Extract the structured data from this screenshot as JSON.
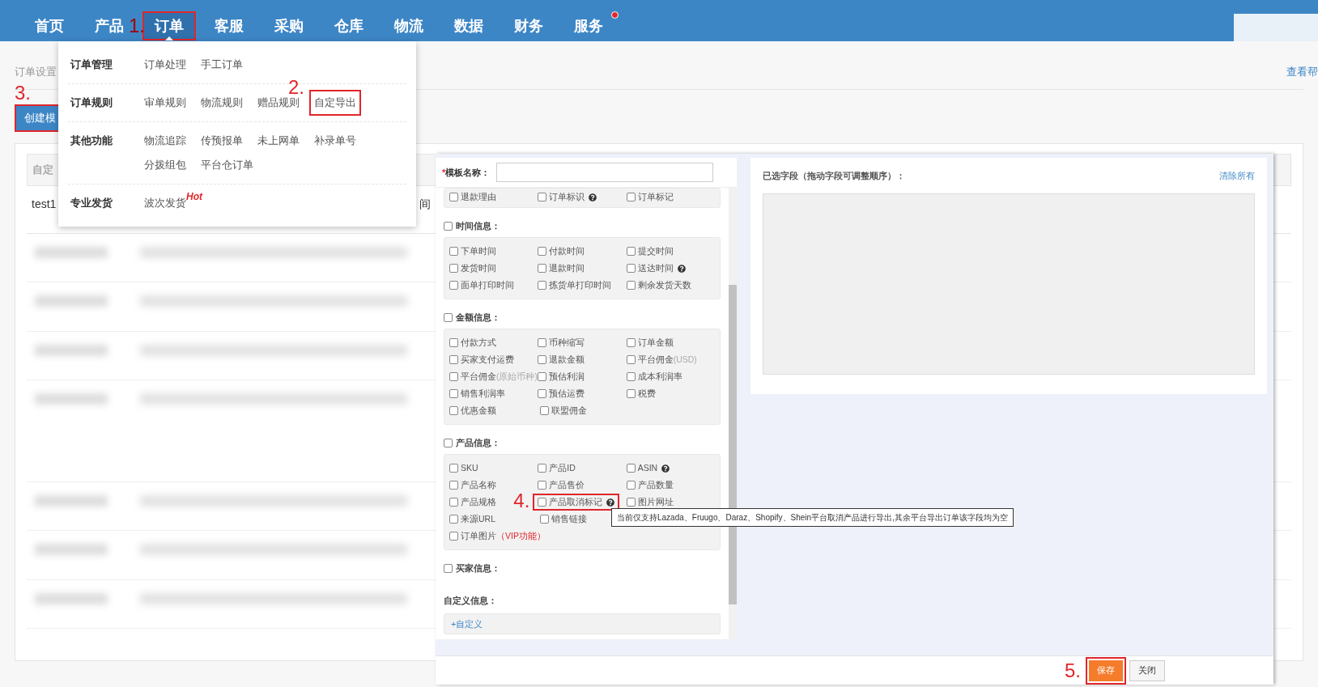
{
  "nav": {
    "items": [
      {
        "label": "首页",
        "selected": false
      },
      {
        "label": "产品",
        "selected": false
      },
      {
        "label": "订单",
        "selected": true,
        "step": "1."
      },
      {
        "label": "客服",
        "selected": false
      },
      {
        "label": "采购",
        "selected": false
      },
      {
        "label": "仓库",
        "selected": false
      },
      {
        "label": "物流",
        "selected": false
      },
      {
        "label": "数据",
        "selected": false
      },
      {
        "label": "财务",
        "selected": false
      },
      {
        "label": "服务",
        "selected": false,
        "badge": true
      }
    ]
  },
  "page": {
    "breadcrumb": "订单设置",
    "help_link": "查看帮",
    "create_button": {
      "label": "创建模",
      "step": "3."
    },
    "table": {
      "header": "自定",
      "rows": [
        {
          "cells": [
            "test1",
            "间"
          ]
        }
      ]
    }
  },
  "menu": {
    "groups": [
      {
        "title": "订单管理",
        "items": [
          {
            "label": "订单处理"
          },
          {
            "label": "手工订单"
          }
        ]
      },
      {
        "title": "订单规则",
        "items": [
          {
            "label": "审单规则"
          },
          {
            "label": "物流规则"
          },
          {
            "label": "赠品规则"
          },
          {
            "label": "自定导出",
            "step": "2."
          }
        ]
      },
      {
        "title": "其他功能",
        "items": [
          {
            "label": "物流追踪"
          },
          {
            "label": "传预报单"
          },
          {
            "label": "未上网单"
          },
          {
            "label": "补录单号"
          },
          {
            "label": "分拨组包"
          },
          {
            "label": "平台仓订单"
          }
        ]
      },
      {
        "title": "专业发货",
        "items": [
          {
            "label": "波次发货",
            "badge": "Hot"
          }
        ]
      }
    ]
  },
  "dialog": {
    "name_required_mark": "*",
    "name_label": "模板名称：",
    "sections": [
      {
        "rows": [
          [
            {
              "label": "退款理由",
              "checked": false
            },
            {
              "label": "订单标识",
              "checked": false,
              "help": true
            },
            {
              "label": "订单标记",
              "checked": false
            }
          ]
        ]
      },
      {
        "title": "时间信息：",
        "checked": false,
        "rows": [
          [
            {
              "label": "下单时间",
              "checked": false
            },
            {
              "label": "付款时间",
              "checked": false
            },
            {
              "label": "提交时间",
              "checked": false
            }
          ],
          [
            {
              "label": "发货时间",
              "checked": false
            },
            {
              "label": "退款时间",
              "checked": false
            },
            {
              "label": "送达时间",
              "checked": false,
              "help": true
            }
          ],
          [
            {
              "label": "面单打印时间",
              "checked": false
            },
            {
              "label": "拣货单打印时间",
              "checked": false
            },
            {
              "label": "剩余发货天数",
              "checked": false
            }
          ]
        ]
      },
      {
        "title": "金额信息：",
        "checked": false,
        "rows": [
          [
            {
              "label": "付款方式",
              "checked": false
            },
            {
              "label": "币种缩写",
              "checked": false
            },
            {
              "label": "订单金额",
              "checked": false
            }
          ],
          [
            {
              "label": "买家支付运费",
              "checked": false
            },
            {
              "label": "退款金额",
              "checked": false
            },
            {
              "label": "平台佣金",
              "checked": false,
              "note": "(USD)",
              "note_alert": false
            }
          ],
          [
            {
              "label": "平台佣金",
              "checked": false,
              "note": "(原始币种)",
              "note_alert": false
            },
            {
              "label": "预估利润",
              "checked": false
            },
            {
              "label": "成本利润率",
              "checked": false
            }
          ],
          [
            {
              "label": "销售利润率",
              "checked": false
            },
            {
              "label": "预估运费",
              "checked": false
            },
            {
              "label": "税费",
              "checked": false
            }
          ],
          [
            {
              "label": "优惠金额",
              "checked": false
            },
            {
              "label": "联盟佣金",
              "checked": false
            }
          ]
        ]
      },
      {
        "title": "产品信息：",
        "checked": false,
        "rows": [
          [
            {
              "label": "SKU",
              "checked": false
            },
            {
              "label": "产品ID",
              "checked": false
            },
            {
              "label": "ASIN",
              "checked": false,
              "help": true
            }
          ],
          [
            {
              "label": "产品名称",
              "checked": false
            },
            {
              "label": "产品售价",
              "checked": false
            },
            {
              "label": "产品数量",
              "checked": false
            }
          ],
          [
            {
              "label": "产品规格",
              "checked": false
            },
            {
              "label": "产品取消标记",
              "checked": false,
              "help": true,
              "step": "4."
            },
            {
              "label": "图片网址",
              "checked": false
            }
          ],
          [
            {
              "label": "来源URL",
              "checked": false
            },
            {
              "label": "销售链接",
              "checked": false
            }
          ],
          [
            {
              "label": "订单图片",
              "checked": false,
              "note": "（VIP功能）",
              "note_alert": true
            }
          ]
        ]
      },
      {
        "title": "买家信息：",
        "checked": false
      }
    ],
    "custom": {
      "title": "自定义信息：",
      "link": "+自定义"
    },
    "tooltip": "当前仅支持Lazada、Fruugo、Daraz、Shopify、Shein平台取消产品进行导出,其余平台导出订单该字段均为空",
    "selected_title": "已选字段（拖动字段可调整顺序）：",
    "clear_link": "清除所有",
    "buttons": [
      {
        "label": "保存",
        "kind": "primary",
        "step": "5."
      },
      {
        "label": "关闭",
        "kind": "default"
      }
    ]
  }
}
